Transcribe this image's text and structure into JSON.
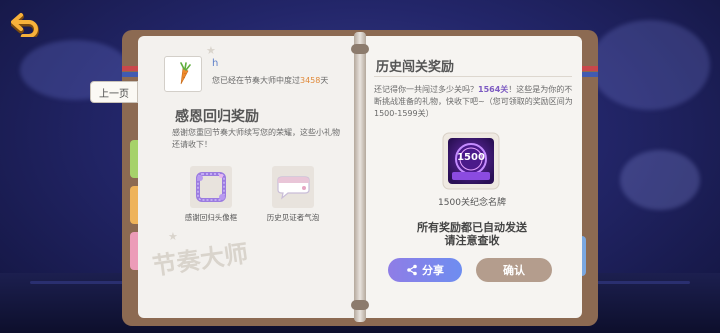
{
  "nav": {
    "back_icon": "back-arrow-icon",
    "prev_page_label": "上一页"
  },
  "profile": {
    "username": "h",
    "days_prefix": "您已经在节奏大师中度过",
    "days_value": "3458",
    "days_suffix": "天",
    "avatar_icon": "carrot-icon"
  },
  "left_page": {
    "title": "感恩回归奖励",
    "description": "感谢您重回节奏大师续写您的荣耀，这些小礼物还请收下！",
    "rewards": [
      {
        "label": "感谢回归头像框",
        "icon": "avatar-frame-icon"
      },
      {
        "label": "历史见证者气泡",
        "icon": "chat-bubble-icon"
      }
    ],
    "watermark": "节奏大师"
  },
  "right_page": {
    "title": "历史闯关奖励",
    "desc_prefix": "还记得你一共闯过多少关吗？",
    "desc_count": "1564关",
    "desc_suffix": "！这些是为你的不断挑战准备的礼物，快收下吧~（您可领取的奖励区间为1500-1599关）",
    "badge_number": "1500",
    "badge_label": "1500关纪念名牌",
    "notice_line1": "所有奖励都已自动发送",
    "notice_line2": "请注意查收",
    "share_label": "分享",
    "confirm_label": "确认"
  },
  "colors": {
    "accent_purple": "#7d5bc2",
    "highlight_orange": "#e08a3a",
    "back_orange": "#f7b13b"
  }
}
